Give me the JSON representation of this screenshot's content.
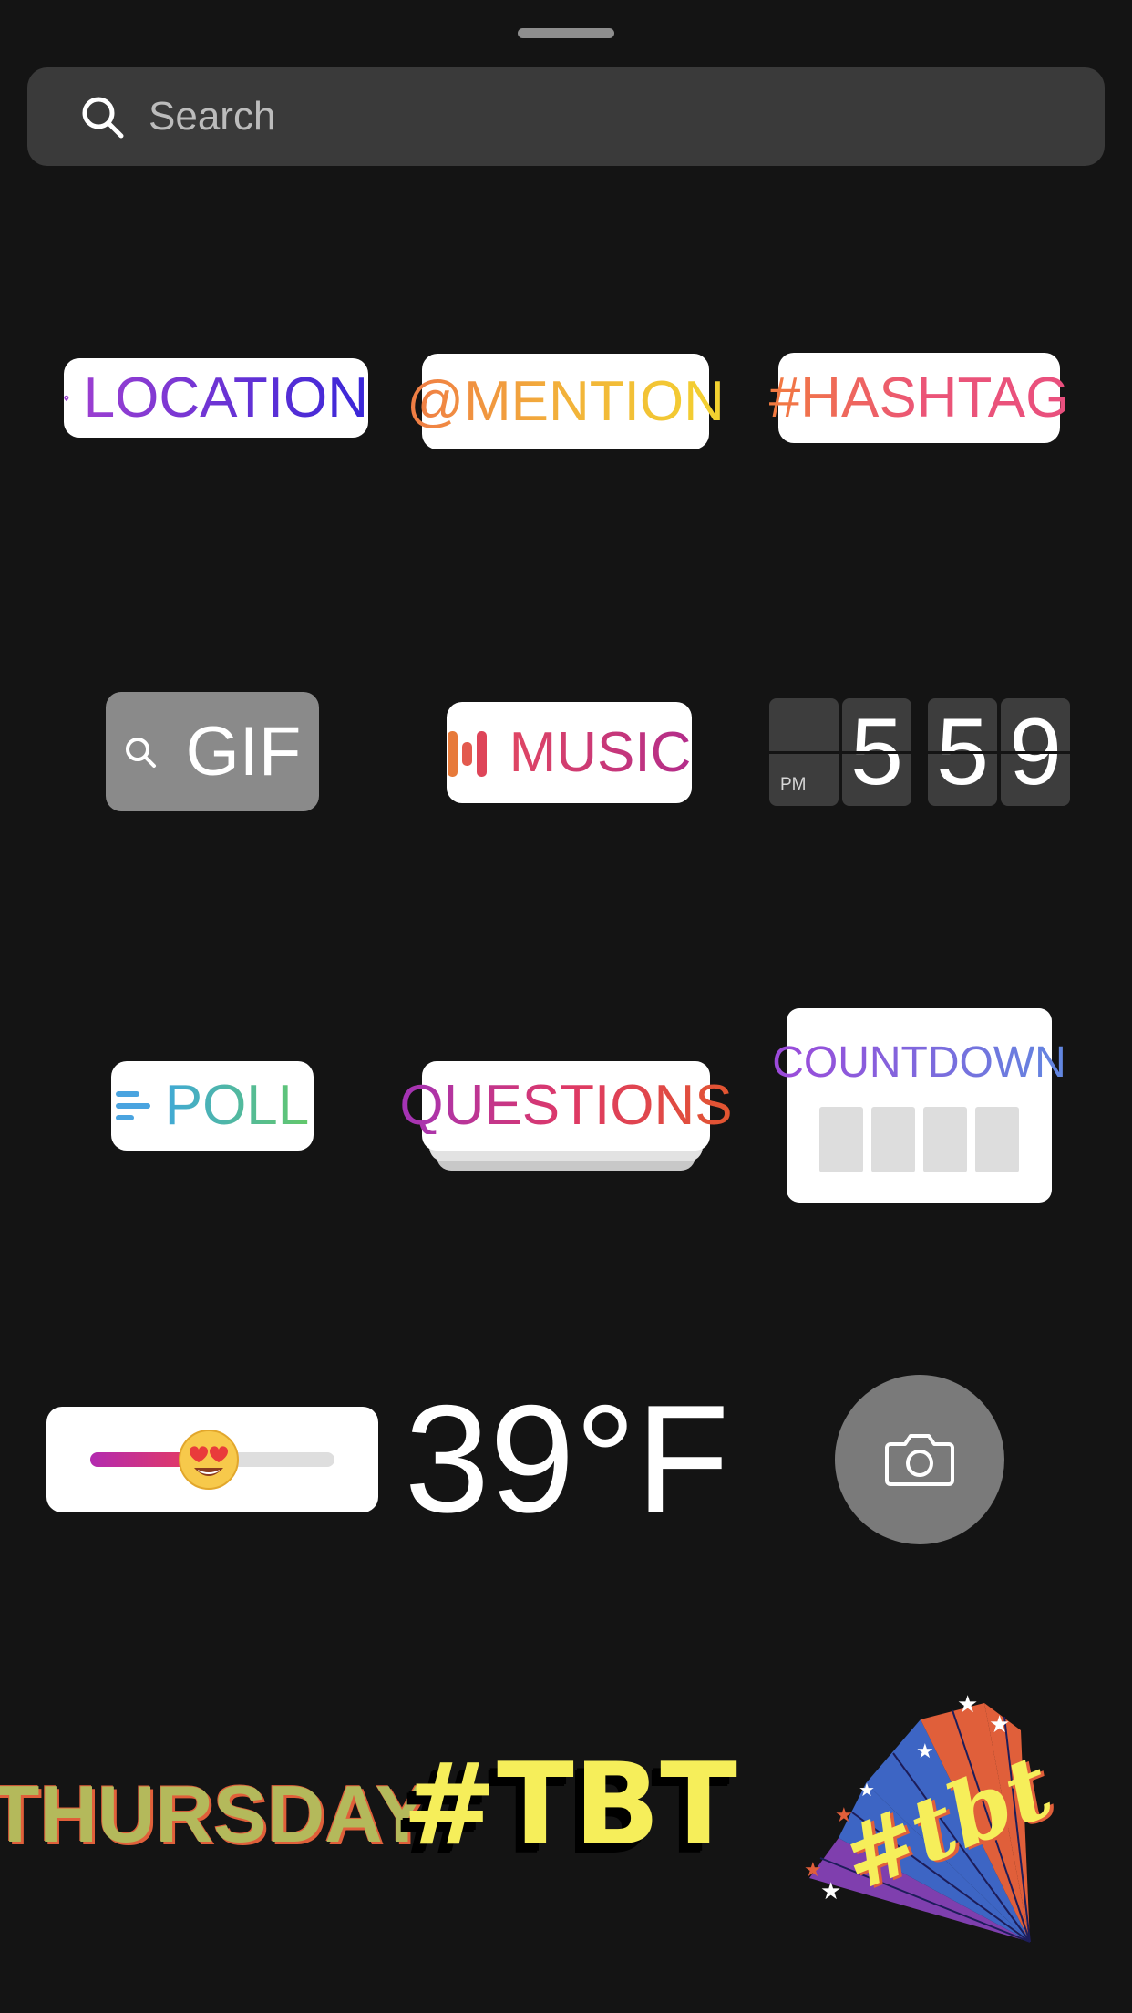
{
  "search": {
    "placeholder": "Search"
  },
  "stickers": {
    "location": "LOCATION",
    "mention": "@MENTION",
    "hashtag": "#HASHTAG",
    "gif": "GIF",
    "music": "MUSIC",
    "clock": {
      "period": "PM",
      "digits": [
        "5",
        "5",
        "9"
      ]
    },
    "poll": "POLL",
    "questions": "QUESTIONS",
    "countdown": "COUNTDOWN",
    "temperature": "39°F",
    "thursday": "THURSDAY",
    "tbt_text": "#TBT",
    "tbt_script": "#tbt"
  },
  "colors": {
    "background": "#141414",
    "search_bg": "#3a3a3a",
    "location_gradient": [
      "#9b3fd1",
      "#3927d8"
    ],
    "mention_gradient": [
      "#ef7b45",
      "#f3d330"
    ],
    "hashtag_gradient": [
      "#f27b3f",
      "#e94f7e"
    ],
    "music_gradient": [
      "#e04663",
      "#b32c8b"
    ],
    "poll_gradient": [
      "#40a9d6",
      "#63c86a"
    ],
    "questions_gradient": [
      "#a233b8",
      "#e2562f"
    ],
    "countdown_gradient": [
      "#9d49da",
      "#6187e0"
    ]
  },
  "slider": {
    "emoji": "heart-eyes-emoji",
    "level": 0.4
  }
}
